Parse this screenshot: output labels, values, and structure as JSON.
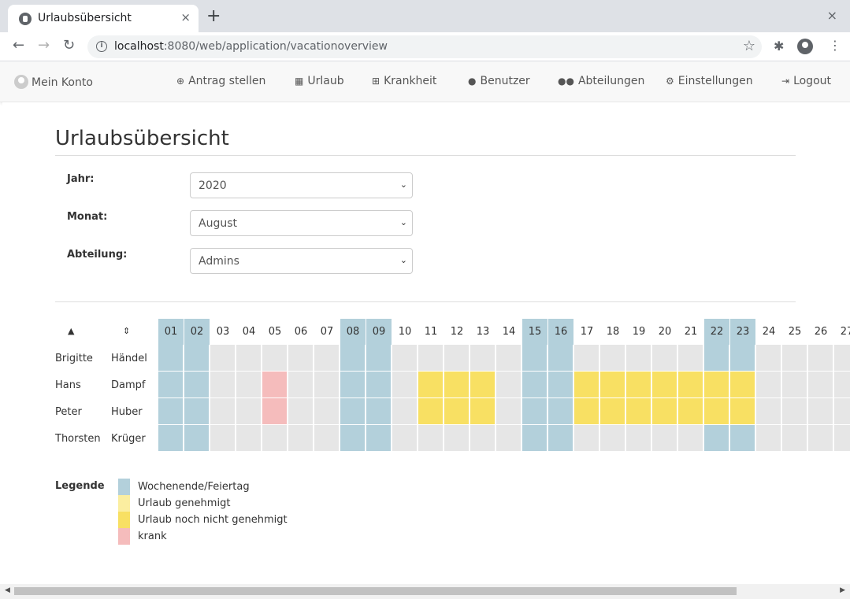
{
  "browser": {
    "tab_title": "Urlaubsübersicht",
    "tab_close": "×",
    "new_tab": "+",
    "window_close": "×",
    "url_host": "localhost",
    "url_rest": ":8080/web/application/vacationoverview"
  },
  "nav": {
    "account": "Mein Konto",
    "items": [
      {
        "label": "Antrag stellen",
        "icon": "plus-circle-icon"
      },
      {
        "label": "Urlaub",
        "icon": "calendar-icon"
      },
      {
        "label": "Krankheit",
        "icon": "medkit-icon"
      },
      {
        "label": "Benutzer",
        "icon": "user-icon"
      },
      {
        "label": "Abteilungen",
        "icon": "users-icon"
      },
      {
        "label": "Einstellungen",
        "icon": "gear-icon"
      },
      {
        "label": "Logout",
        "icon": "logout-icon"
      }
    ]
  },
  "page": {
    "title": "Urlaubsübersicht"
  },
  "filters": {
    "year_label": "Jahr:",
    "year_value": "2020",
    "month_label": "Monat:",
    "month_value": "August",
    "department_label": "Abteilung:",
    "department_value": "Admins"
  },
  "calendar": {
    "days": [
      "01",
      "02",
      "03",
      "04",
      "05",
      "06",
      "07",
      "08",
      "09",
      "10",
      "11",
      "12",
      "13",
      "14",
      "15",
      "16",
      "17",
      "18",
      "19",
      "20",
      "21",
      "22",
      "23",
      "24",
      "25",
      "26",
      "27"
    ],
    "weekend_days": [
      "01",
      "02",
      "08",
      "09",
      "15",
      "16",
      "22",
      "23"
    ],
    "rows": [
      {
        "first": "Brigitte",
        "last": "Händel",
        "pending": [],
        "sick": []
      },
      {
        "first": "Hans",
        "last": "Dampf",
        "pending": [
          "11",
          "12",
          "13",
          "17",
          "18",
          "19",
          "20",
          "21",
          "22",
          "23"
        ],
        "sick": [
          "05"
        ]
      },
      {
        "first": "Peter",
        "last": "Huber",
        "pending": [
          "11",
          "12",
          "13",
          "17",
          "18",
          "19",
          "20",
          "21",
          "22",
          "23"
        ],
        "sick": [
          "05"
        ]
      },
      {
        "first": "Thorsten",
        "last": "Krüger",
        "pending": [],
        "sick": []
      }
    ]
  },
  "legend": {
    "title": "Legende",
    "items": [
      {
        "label": "Wochenende/Feiertag",
        "color": "#b3d0db"
      },
      {
        "label": "Urlaub genehmigt",
        "color": "#fbeea0"
      },
      {
        "label": "Urlaub noch nicht genehmigt",
        "color": "#f8e063"
      },
      {
        "label": "krank",
        "color": "#f5bcbc"
      }
    ]
  }
}
